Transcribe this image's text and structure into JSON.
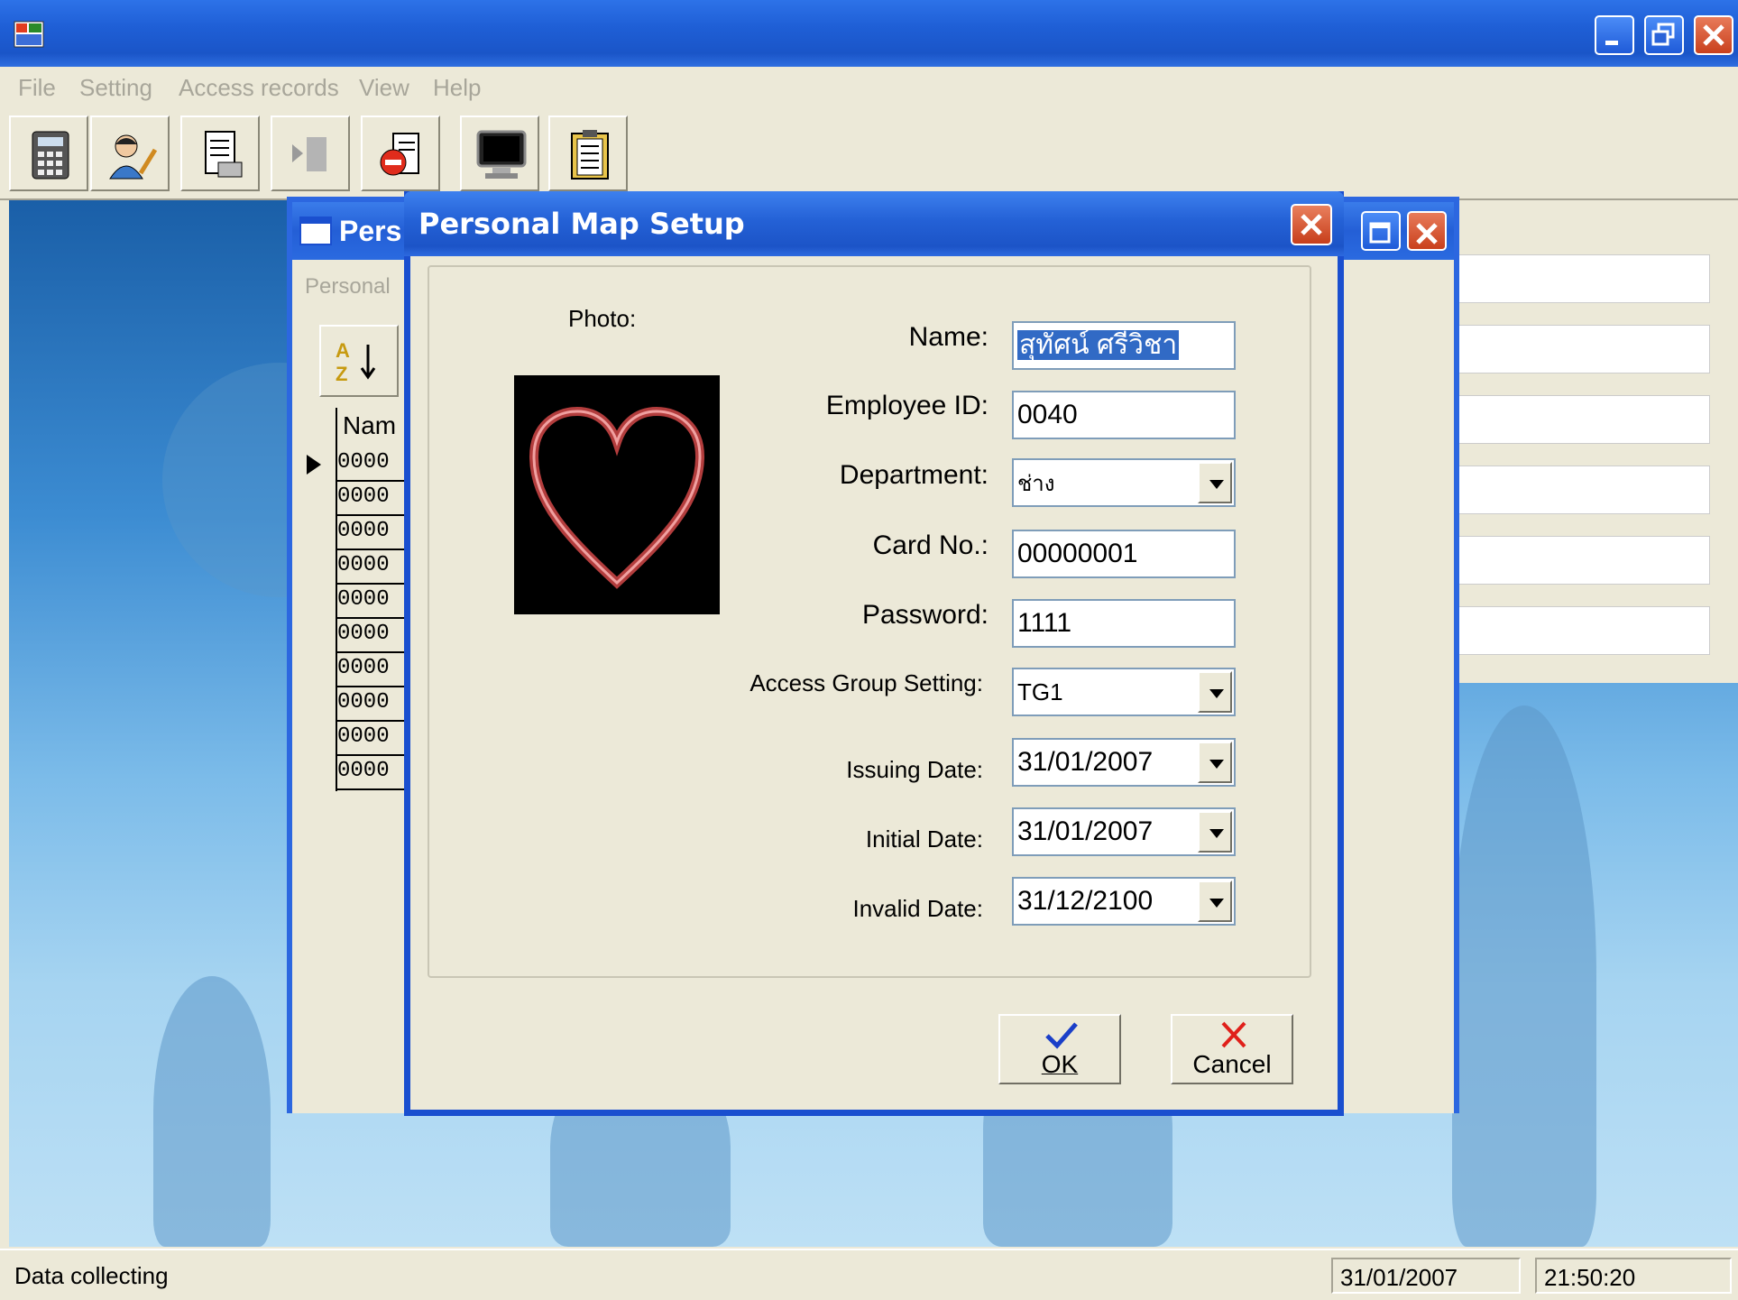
{
  "menu": [
    "File",
    "Setting",
    "Access records",
    "View",
    "Help"
  ],
  "bg_window": {
    "title": "Pers",
    "tab": "Personal",
    "grid_header": "Nam",
    "rows": [
      "0000",
      "0000",
      "0000",
      "0000",
      "0000",
      "0000",
      "0000",
      "0000",
      "0000",
      "0000"
    ]
  },
  "dialog": {
    "title": "Personal Map Setup",
    "photo_label": "Photo:",
    "labels": {
      "name": "Name:",
      "employee_id": "Employee ID:",
      "department": "Department:",
      "card_no": "Card No.:",
      "password": "Password:",
      "access_group": "Access Group Setting:",
      "issuing_date": "Issuing Date:",
      "initial_date": "Initial Date:",
      "invalid_date": "Invalid Date:"
    },
    "values": {
      "name": "สุทัศน์ ศรีวิชา",
      "employee_id": "0040",
      "department": "ช่าง",
      "card_no": "00000001",
      "password": "1111",
      "access_group": "TG1",
      "issuing_date": "31/01/2007",
      "initial_date": "31/01/2007",
      "invalid_date": "31/12/2100"
    },
    "ok_label": "OK",
    "cancel_label": "Cancel"
  },
  "status": {
    "message": "Data collecting",
    "date": "31/01/2007",
    "time": "21:50:20"
  },
  "colors": {
    "titlebar": "#2461d6",
    "selection": "#316ac5",
    "ok_check": "#1a3fc8",
    "cancel_x": "#e0201a"
  }
}
